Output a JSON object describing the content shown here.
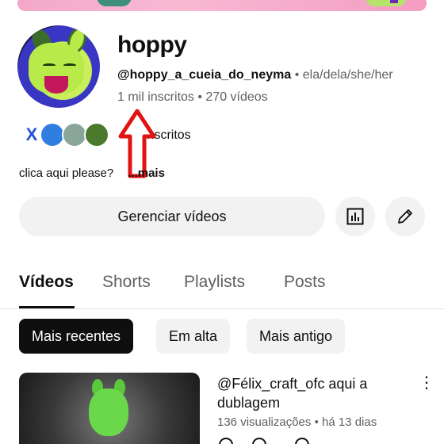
{
  "channel": {
    "name": "hoppy",
    "handle": "@hoppy_a_cueia_do_neyma",
    "separator": "•",
    "pronouns": "ela/dela/she/her",
    "stats": "1 mil inscritos • 270 vídeos",
    "subscribers_note": "inscritos",
    "description": "clica aqui please?",
    "more_label": "...mais"
  },
  "actions": {
    "manage_label": "Gerenciar vídeos",
    "stats_icon": "analytics-icon",
    "edit_icon": "pencil-icon"
  },
  "tabs": [
    {
      "label": "Vídeos",
      "active": true
    },
    {
      "label": "Shorts",
      "active": false
    },
    {
      "label": "Playlists",
      "active": false
    },
    {
      "label": "Posts",
      "active": false
    }
  ],
  "chips": [
    {
      "label": "Mais recentes",
      "active": true
    },
    {
      "label": "Em alta",
      "active": false
    },
    {
      "label": "Mais antigo",
      "active": false
    }
  ],
  "videos": [
    {
      "title": "@Félix_craft_ofc aqui a dublagem",
      "meta": "136 visualizações • há 13 dias"
    }
  ],
  "colors": {
    "arrow": "#e11414",
    "active_chip": "#0f0f0f",
    "chip_bg": "#f2f2f2",
    "secondary_text": "#606060"
  }
}
